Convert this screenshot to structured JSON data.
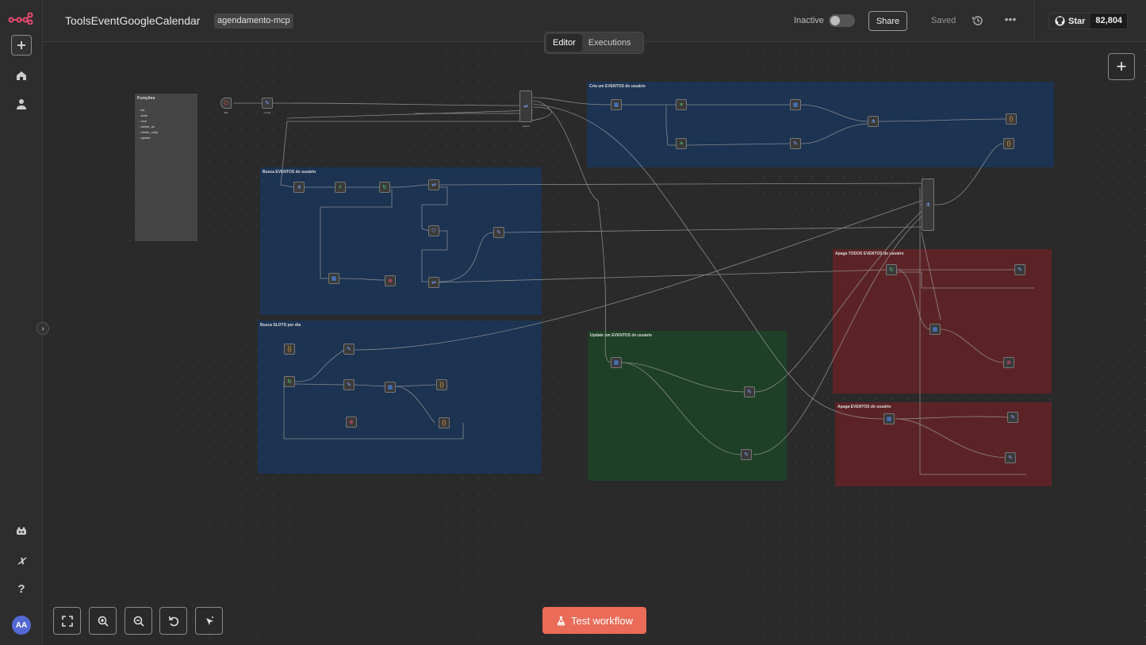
{
  "header": {
    "workflow_title": "ToolsEventGoogleCalendar",
    "tag": "agendamento-mcp",
    "status_label": "Inactive",
    "share_label": "Share",
    "saved_label": "Saved",
    "star_label": "Star",
    "star_count": "82,804"
  },
  "tabs": [
    {
      "label": "Editor",
      "active": true
    },
    {
      "label": "Executions",
      "active": false
    }
  ],
  "sidebar": {
    "avatar_initials": "AA"
  },
  "canvas": {
    "notes": {
      "title": "Funções",
      "items": [
        "- list",
        "- slots",
        "- new",
        "- delete_all",
        "- delete_unity",
        "- update"
      ]
    },
    "groups": {
      "cria": "Cria um EVENTOS do usuário",
      "busca_eventos": "Busca EVENTOS do usuário",
      "busca_slots": "Busca SLOTS por dia",
      "update": "Update um EVENTOS do usuário",
      "apaga_todos": "Apaga TODOS EVENTOS do usuário",
      "apaga": "Apaga EVENTOS do usuário"
    },
    "edge_label": "Item"
  },
  "footer": {
    "test_workflow_label": "Test workflow"
  },
  "colors": {
    "accent": "#ea6b58",
    "sticky_blue": "#1c3352",
    "sticky_red": "#5c2326",
    "sticky_green": "#1e4026"
  }
}
